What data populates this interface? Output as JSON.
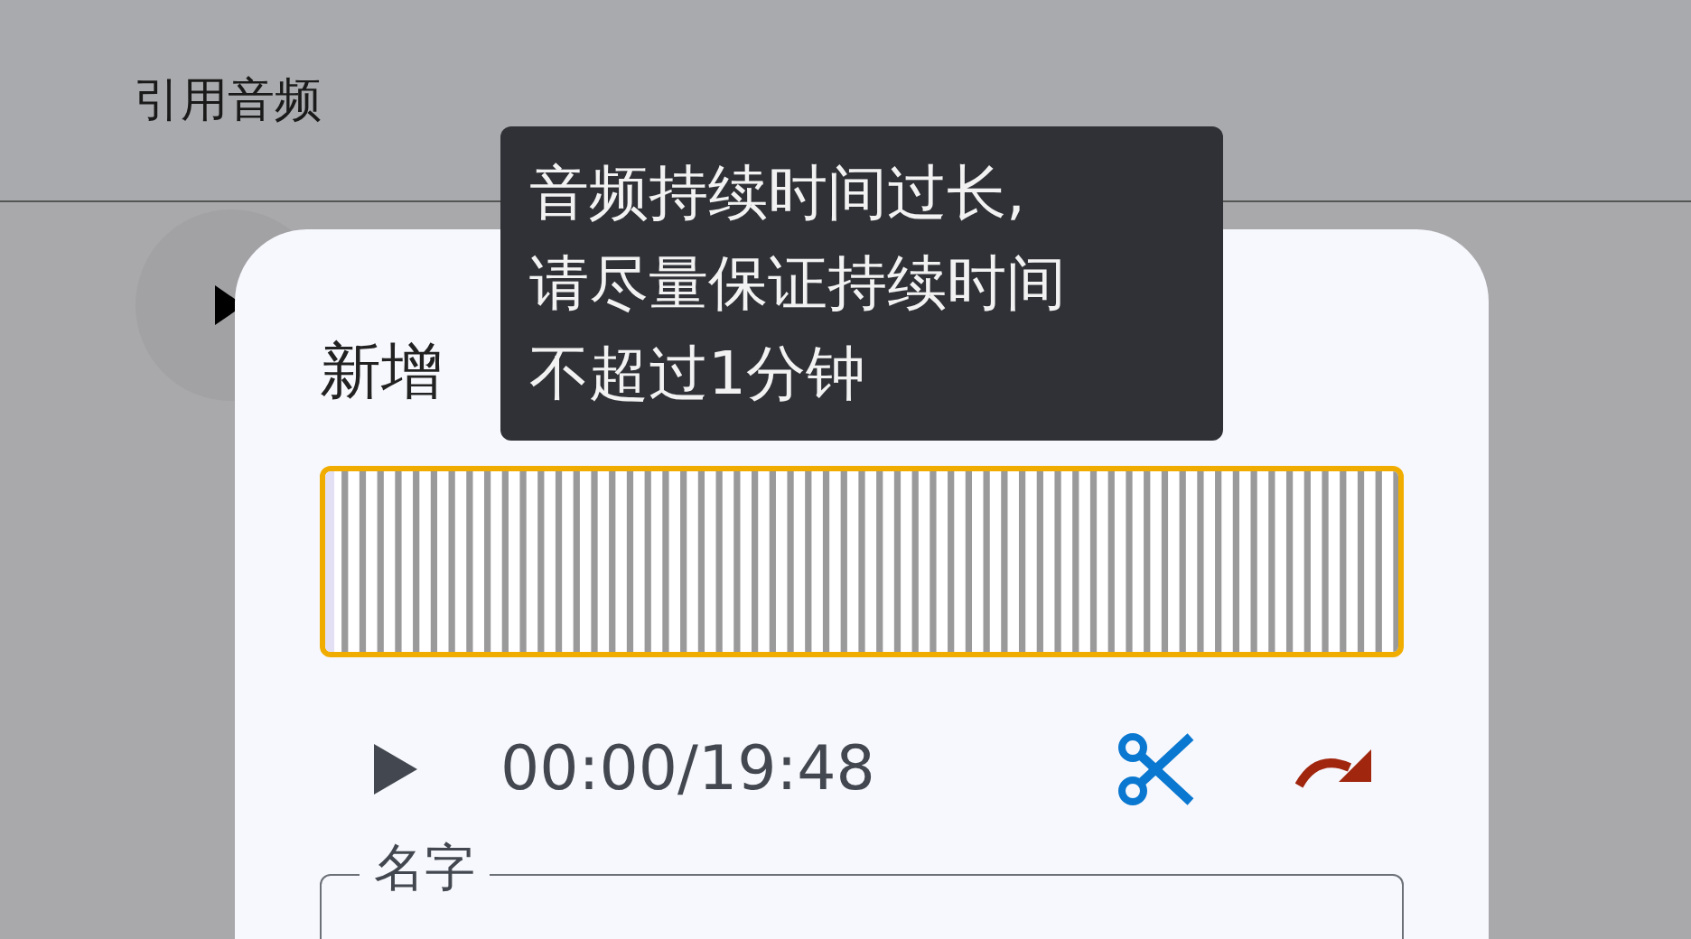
{
  "header": {
    "title": "引用音频"
  },
  "dialog": {
    "title": "新增",
    "player": {
      "time": "00:00/19:48"
    },
    "name_field": {
      "label": "名字"
    }
  },
  "tooltip": {
    "lines": [
      "音频持续时间过长,",
      "请尽量保证持续时间",
      "不超过1分钟"
    ]
  }
}
